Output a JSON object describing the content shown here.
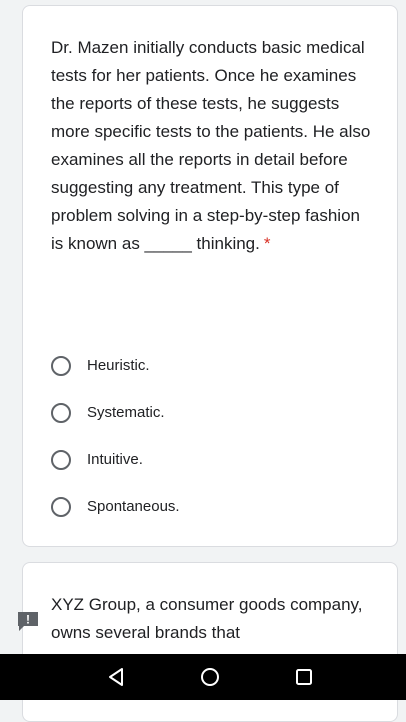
{
  "question1": {
    "text": "Dr. Mazen initially conducts basic medical tests for her patients. Once he examines the reports of these tests, he suggests more specific tests to the patients. He also examines all the reports in detail before suggesting any treatment. This type of problem solving in a step-by-step fashion is known as _____ thinking.",
    "required_marker": "*",
    "options": [
      {
        "label": "Heuristic."
      },
      {
        "label": "Systematic."
      },
      {
        "label": "Intuitive."
      },
      {
        "label": "Spontaneous."
      }
    ]
  },
  "question2": {
    "text": "XYZ Group, a consumer goods company, owns several brands that"
  },
  "report_button": {
    "icon": "report-icon",
    "glyph": "!"
  },
  "navigation_bar": {
    "back_icon": "back-triangle-icon",
    "home_icon": "home-circle-icon",
    "recents_icon": "recents-square-icon"
  },
  "colors": {
    "background": "#f1f3f4",
    "card": "#ffffff",
    "required": "#d93025",
    "radio_border": "#5f6368",
    "report_icon": "#5f6368",
    "navbar": "#000000"
  }
}
